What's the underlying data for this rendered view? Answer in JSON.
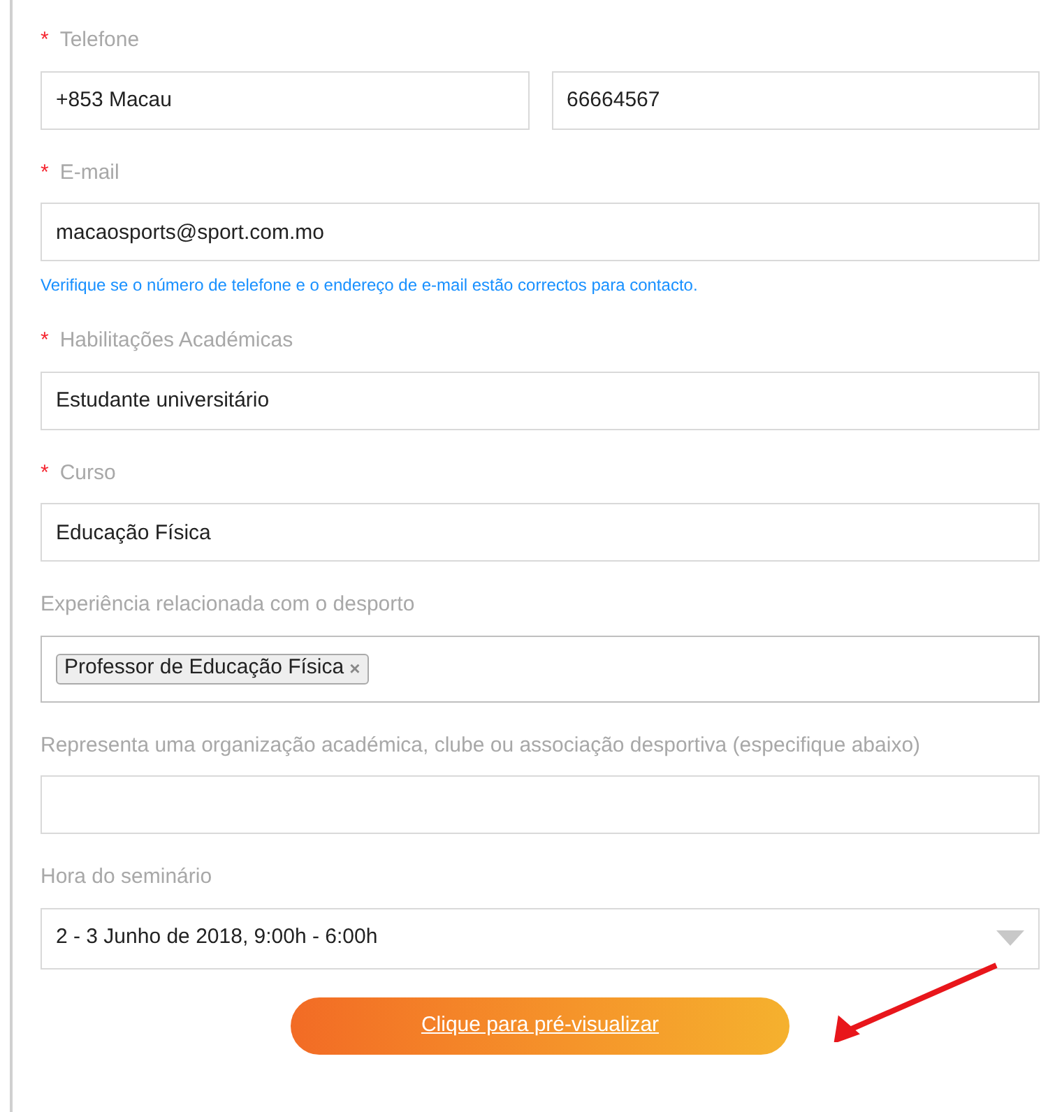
{
  "fields": [
    {
      "kind": "phone",
      "label": "Telefone",
      "required_mark": "*",
      "values": [
        "+853 Macau",
        "66664567"
      ]
    },
    {
      "kind": "text",
      "label": "E-mail",
      "required_mark": "*",
      "value": "macaosports@sport.com.mo",
      "hint": "Verifique se o número de telefone e o endereço de e-mail estão correctos para contacto."
    },
    {
      "kind": "text",
      "label": "Habilitações Académicas",
      "required_mark": "*",
      "value": "Estudante universitário"
    },
    {
      "kind": "text",
      "label": "Curso",
      "required_mark": "*",
      "value": "Educação Física"
    },
    {
      "kind": "tags",
      "label": "Experiência relacionada com o desporto",
      "tags": [
        {
          "label": "Professor de Educação Física",
          "remove": "×"
        }
      ]
    },
    {
      "kind": "text",
      "label": "Representa uma organização académica, clube ou associação desportiva (especifique abaixo)"
    },
    {
      "kind": "select",
      "label": "Hora do seminário",
      "value": "2 - 3 Junho de 2018, 9:00h - 6:00h"
    }
  ],
  "button": {
    "label": "Clique para pré-visualizar"
  }
}
